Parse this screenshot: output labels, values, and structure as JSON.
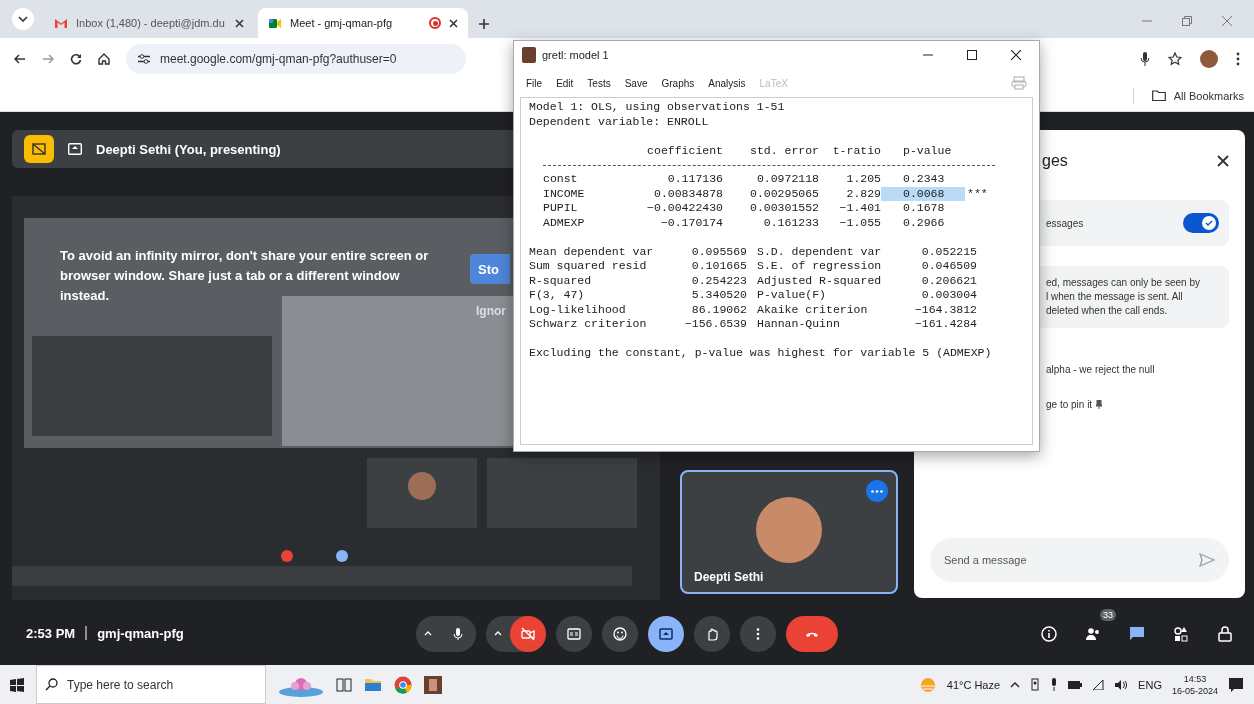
{
  "browser": {
    "tabs": [
      {
        "title": "Inbox (1,480) - deepti@jdm.du",
        "kind": "mail",
        "selected": false
      },
      {
        "title": "Meet - gmj-qman-pfg",
        "kind": "meet",
        "selected": true,
        "recording": true
      }
    ],
    "address": "meet.google.com/gmj-qman-pfg?authuser=0",
    "bookmarks": [
      "All Bookmarks"
    ]
  },
  "meet": {
    "presenting_banner": "Deepti Sethi (You, presenting)",
    "mirror_warning": {
      "text": "To avoid an infinity mirror, don't share your entire screen or browser window. Share just a tab or a different window instead.",
      "stop_button": "Sto",
      "ignore_button": "Ignor"
    },
    "self_tile": {
      "name": "Deepti Sethi"
    },
    "chat": {
      "title": "ges",
      "toggle": {
        "label": "essages",
        "on": true
      },
      "info": [
        "ed, messages can only be seen by",
        "l when the message is sent. All",
        "deleted when the call ends."
      ],
      "messages": [
        {
          "text": "alpha - we reject the null"
        },
        {
          "text": "ge to pin it"
        }
      ],
      "input": {
        "placeholder": "Send a message"
      }
    },
    "bottom_bar": {
      "time": "2:53 PM",
      "meeting_code": "gmj-qman-pfg",
      "controls": [
        {
          "kind": "mic",
          "caret": true
        },
        {
          "kind": "camera",
          "caret": true,
          "on": false
        },
        {
          "kind": "captions"
        },
        {
          "kind": "emoji"
        },
        {
          "kind": "present",
          "selected": true
        },
        {
          "kind": "hand"
        },
        {
          "kind": "more"
        },
        {
          "kind": "end"
        }
      ],
      "side_controls": [
        {
          "kind": "info",
          "selected": false
        },
        {
          "kind": "people",
          "selected": false,
          "badge": "33"
        },
        {
          "kind": "chat",
          "selected": true
        },
        {
          "kind": "activities",
          "selected": false
        },
        {
          "kind": "lock",
          "selected": false
        }
      ]
    }
  },
  "gretl": {
    "title": "gretl: model 1",
    "menu": [
      {
        "label": "File",
        "disabled": false
      },
      {
        "label": "Edit",
        "disabled": false
      },
      {
        "label": "Tests",
        "disabled": false
      },
      {
        "label": "Save",
        "disabled": false
      },
      {
        "label": "Graphs",
        "disabled": false
      },
      {
        "label": "Analysis",
        "disabled": false
      },
      {
        "label": "LaTeX",
        "disabled": true
      }
    ],
    "header": [
      "Model 1: OLS, using observations 1-51",
      "Dependent variable: ENROLL"
    ],
    "columns": [
      "coefficient",
      "std. error",
      "t-ratio",
      "p-value"
    ],
    "rows": [
      {
        "name": "const",
        "values": [
          "0.117136",
          "0.0972118",
          "1.205",
          "0.2343"
        ],
        "selected": false
      },
      {
        "name": "INCOME",
        "values": [
          "0.00834878",
          "0.00295065",
          "2.829",
          "0.0068"
        ],
        "stars": "***",
        "selected": true
      },
      {
        "name": "PUPIL",
        "values": [
          "−0.00422430",
          "0.00301552",
          "−1.401",
          "0.1678"
        ],
        "selected": false
      },
      {
        "name": "ADMEXP",
        "values": [
          "−0.170174",
          "0.161233",
          "−1.055",
          "0.2966"
        ],
        "selected": false
      }
    ],
    "stats": [
      [
        "Mean dependent var",
        "0.095569",
        "S.D. dependent var",
        "0.052215"
      ],
      [
        "Sum squared resid",
        "0.101665",
        "S.E. of regression",
        "0.046509"
      ],
      [
        "R-squared",
        "0.254223",
        "Adjusted R-squared",
        "0.206621"
      ],
      [
        "F(3, 47)",
        "5.340520",
        "P-value(F)",
        "0.003004"
      ],
      [
        "Log-likelihood",
        "86.19062",
        "Akaike criterion",
        "−164.3812"
      ],
      [
        "Schwarz criterion",
        "−156.6539",
        "Hannan-Quinn",
        "−161.4284"
      ]
    ],
    "footer": "Excluding the constant, p-value was highest for variable 5 (ADMEXP)"
  },
  "taskbar": {
    "search_placeholder": "Type here to search",
    "weather": "41°C Haze",
    "language": "ENG",
    "time": "14:53",
    "date": "16-05-2024"
  }
}
